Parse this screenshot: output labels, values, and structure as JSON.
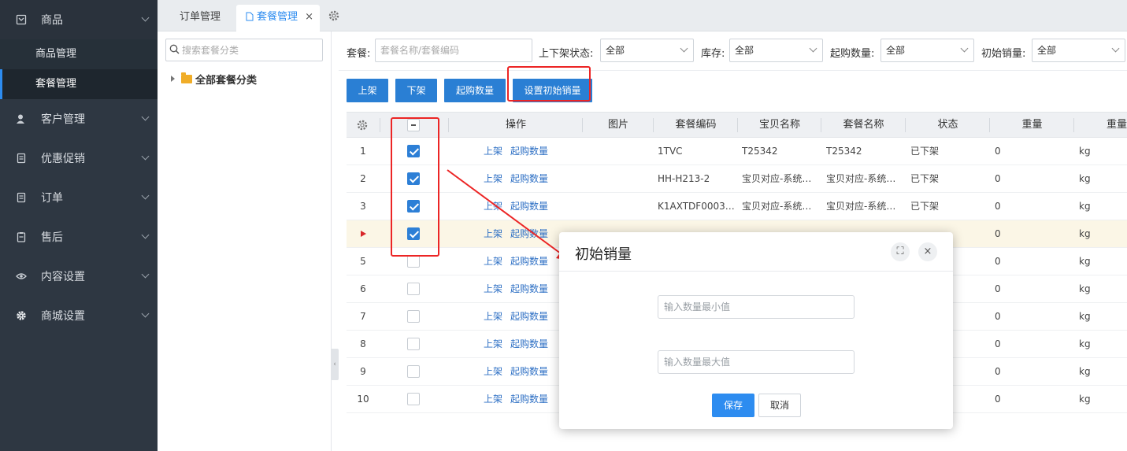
{
  "sidebar": {
    "groups": [
      {
        "label": "商品",
        "icon": "package-icon"
      },
      {
        "label": "客户管理",
        "icon": "user-icon"
      },
      {
        "label": "优惠促销",
        "icon": "coupon-icon"
      },
      {
        "label": "订单",
        "icon": "list-icon"
      },
      {
        "label": "售后",
        "icon": "clipboard-icon"
      },
      {
        "label": "内容设置",
        "icon": "eye-icon"
      },
      {
        "label": "商城设置",
        "icon": "gear-icon"
      }
    ],
    "sub_items": [
      {
        "label": "商品管理"
      },
      {
        "label": "套餐管理"
      }
    ]
  },
  "tabs": [
    {
      "label": "订单管理"
    },
    {
      "label": "套餐管理",
      "close": "×"
    }
  ],
  "tree": {
    "search_placeholder": "搜索套餐分类",
    "root_label": "全部套餐分类",
    "collapse": "‹"
  },
  "filters": {
    "package_label": "套餐:",
    "package_placeholder": "套餐名称/套餐编码",
    "status_label": "上下架状态:",
    "status_value": "全部",
    "stock_label": "库存:",
    "stock_value": "全部",
    "min_qty_label": "起购数量:",
    "min_qty_value": "全部",
    "init_sales_label": "初始销量:",
    "init_sales_value": "全部"
  },
  "toolbar": {
    "shelf_on": "上架",
    "shelf_off": "下架",
    "min_qty": "起购数量",
    "set_init_sales": "设置初始销量"
  },
  "table": {
    "headers": [
      "操作",
      "图片",
      "套餐编码",
      "宝贝名称",
      "套餐名称",
      "状态",
      "重量",
      "重量单"
    ],
    "rows": [
      {
        "num": "1",
        "checked": true,
        "action1": "上架",
        "action2": "起购数量",
        "code": "1TVC",
        "item": "T25342",
        "pkg": "T25342",
        "status": "已下架",
        "weight": "0",
        "unit": "kg"
      },
      {
        "num": "2",
        "checked": true,
        "action1": "上架",
        "action2": "起购数量",
        "code": "HH-H213-2",
        "item": "宝贝对应-系统…",
        "pkg": "宝贝对应-系统…",
        "status": "已下架",
        "weight": "0",
        "unit": "kg"
      },
      {
        "num": "3",
        "checked": true,
        "action1": "上架",
        "action2": "起购数量",
        "code": "K1AXTDF0003…",
        "item": "宝贝对应-系统…",
        "pkg": "宝贝对应-系统…",
        "status": "已下架",
        "weight": "0",
        "unit": "kg"
      },
      {
        "num": "",
        "checked": true,
        "action1": "上架",
        "action2": "起购数量",
        "code": "",
        "item": "",
        "pkg": "",
        "status": "",
        "weight": "0",
        "unit": "kg"
      },
      {
        "num": "5",
        "checked": false,
        "action1": "上架",
        "action2": "起购数量",
        "code": "",
        "item": "",
        "pkg": "",
        "status": "",
        "weight": "0",
        "unit": "kg"
      },
      {
        "num": "6",
        "checked": false,
        "action1": "上架",
        "action2": "起购数量",
        "code": "",
        "item": "",
        "pkg": "",
        "status": "",
        "weight": "0",
        "unit": "kg"
      },
      {
        "num": "7",
        "checked": false,
        "action1": "上架",
        "action2": "起购数量",
        "code": "",
        "item": "",
        "pkg": "",
        "status": "",
        "weight": "0",
        "unit": "kg"
      },
      {
        "num": "8",
        "checked": false,
        "action1": "上架",
        "action2": "起购数量",
        "code": "",
        "item": "",
        "pkg": "",
        "status": "",
        "weight": "0",
        "unit": "kg"
      },
      {
        "num": "9",
        "checked": false,
        "action1": "上架",
        "action2": "起购数量",
        "code": "",
        "item": "",
        "pkg": "",
        "status": "",
        "weight": "0",
        "unit": "kg"
      },
      {
        "num": "10",
        "checked": false,
        "action1": "上架",
        "action2": "起购数量",
        "code": "",
        "item": "",
        "pkg": "",
        "status": "",
        "weight": "0",
        "unit": "kg"
      }
    ]
  },
  "dialog": {
    "title": "初始销量",
    "expand": "⛶",
    "close": "×",
    "min_placeholder": "输入数量最小值",
    "max_placeholder": "输入数量最大值",
    "save": "保存",
    "cancel": "取消"
  },
  "colors": {
    "sidebar_bg": "#2e3742",
    "primary": "#2a7fd4",
    "annotation_red": "#ec2525",
    "link": "#2d6fc4"
  }
}
